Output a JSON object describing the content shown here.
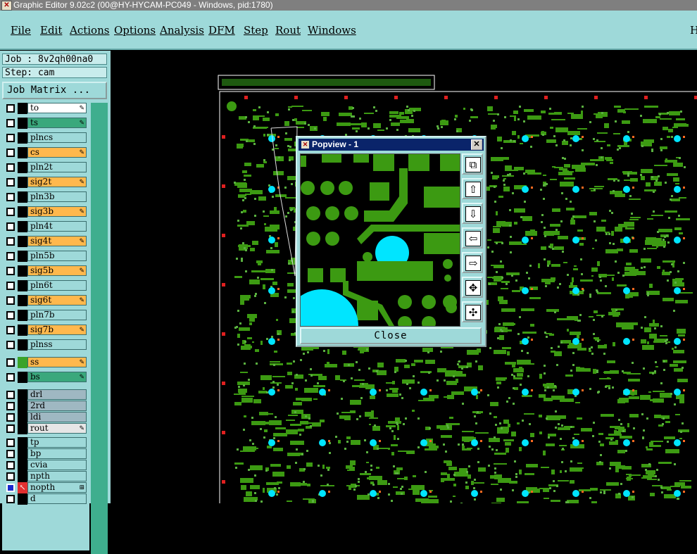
{
  "window": {
    "title": "Graphic Editor 9.02c2 (00@HY-HYCAM-PC049 - Windows, pid:1780)"
  },
  "menu": {
    "items": [
      "File",
      "Edit",
      "Actions",
      "Options",
      "Analysis",
      "DFM",
      "Step",
      "Rout",
      "Windows"
    ],
    "help_label": "H"
  },
  "job": {
    "job_label": "Job : 8v2qh00na0",
    "step_label": "Step: cam",
    "matrix_button": "Job Matrix ..."
  },
  "layers": [
    {
      "name": "to",
      "color": "#ffffff",
      "mark": "✎",
      "swatch": "#000000"
    },
    {
      "name": "ts",
      "color": "#3aa87c",
      "mark": "✎",
      "swatch": "#000000"
    },
    {
      "name": "plncs",
      "color": "#9ed9d9",
      "mark": "",
      "swatch": "#000000"
    },
    {
      "name": "cs",
      "color": "#ffb84d",
      "mark": "✎",
      "swatch": "#000000"
    },
    {
      "name": "pln2t",
      "color": "#9ed9d9",
      "mark": "",
      "swatch": "#000000"
    },
    {
      "name": "sig2t",
      "color": "#ffb84d",
      "mark": "✎",
      "swatch": "#000000"
    },
    {
      "name": "pln3b",
      "color": "#9ed9d9",
      "mark": "",
      "swatch": "#000000"
    },
    {
      "name": "sig3b",
      "color": "#ffb84d",
      "mark": "✎",
      "swatch": "#000000"
    },
    {
      "name": "pln4t",
      "color": "#9ed9d9",
      "mark": "",
      "swatch": "#000000"
    },
    {
      "name": "sig4t",
      "color": "#ffb84d",
      "mark": "✎",
      "swatch": "#000000"
    },
    {
      "name": "pln5b",
      "color": "#9ed9d9",
      "mark": "",
      "swatch": "#000000"
    },
    {
      "name": "sig5b",
      "color": "#ffb84d",
      "mark": "✎",
      "swatch": "#000000"
    },
    {
      "name": "pln6t",
      "color": "#9ed9d9",
      "mark": "",
      "swatch": "#000000"
    },
    {
      "name": "sig6t",
      "color": "#ffb84d",
      "mark": "✎",
      "swatch": "#000000"
    },
    {
      "name": "pln7b",
      "color": "#9ed9d9",
      "mark": "",
      "swatch": "#000000"
    },
    {
      "name": "sig7b",
      "color": "#ffb84d",
      "mark": "✎",
      "swatch": "#000000"
    },
    {
      "name": "plnss",
      "color": "#9ed9d9",
      "mark": "",
      "swatch": "#000000"
    },
    {
      "name": "ss",
      "color": "#ffb84d",
      "mark": "✎",
      "swatch": "#3aa32a"
    },
    {
      "name": "bs",
      "color": "#3aa87c",
      "mark": "✎",
      "swatch": "#000000"
    },
    {
      "name": "drl",
      "color": "#9fb8c2",
      "mark": "",
      "swatch": "#000000"
    },
    {
      "name": "2rd",
      "color": "#9fb8c2",
      "mark": "",
      "swatch": "#000000"
    },
    {
      "name": "ldi",
      "color": "#9fb8c2",
      "mark": "",
      "swatch": "#000000"
    },
    {
      "name": "rout",
      "color": "#e6e6e6",
      "mark": "✎",
      "swatch": "#000000"
    },
    {
      "name": "tp",
      "color": "#9ed9d9",
      "mark": "",
      "swatch": "#000000"
    },
    {
      "name": "bp",
      "color": "#9ed9d9",
      "mark": "",
      "swatch": "#000000"
    },
    {
      "name": "cvia",
      "color": "#9ed9d9",
      "mark": "",
      "swatch": "#000000"
    },
    {
      "name": "npth",
      "color": "#9ed9d9",
      "mark": "",
      "swatch": "#000000"
    },
    {
      "name": "nopth",
      "color": "#9ed9d9",
      "mark": "⊞",
      "swatch": "#e23030"
    },
    {
      "name": "d",
      "color": "#9ed9d9",
      "mark": "",
      "swatch": "#000000"
    }
  ],
  "popview": {
    "title": "Popview - 1",
    "close_label": "Close",
    "tools": [
      "zoom-fit-icon",
      "pan-up-icon",
      "pan-down-icon",
      "pan-left-icon",
      "pan-right-icon",
      "zoom-in-icon",
      "zoom-out-icon"
    ]
  },
  "colors": {
    "copper": "#3c9a12",
    "pad_cyan": "#00e5ff",
    "drill_red": "#e02020",
    "panel": "#9ed9d9"
  }
}
